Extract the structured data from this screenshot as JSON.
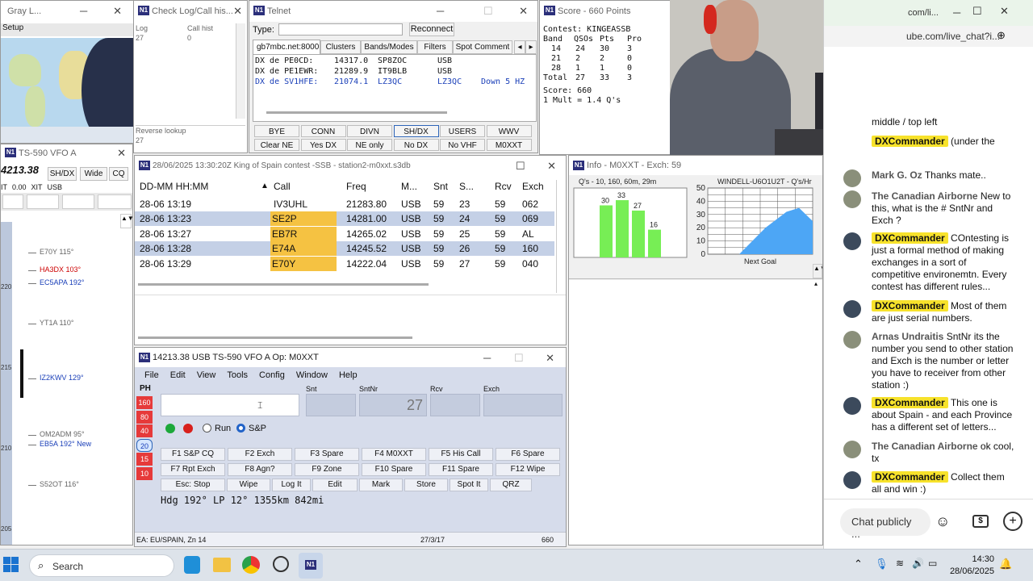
{
  "gray_line": {
    "title": "Gray L...",
    "setup": "Setup"
  },
  "check_log": {
    "title": "Check Log/Call his...",
    "log_label": "Log",
    "log_value": "27",
    "callhist_label": "Call hist",
    "callhist_value": "0",
    "reverse_label": "Reverse lookup",
    "reverse_value": "27"
  },
  "telnet": {
    "title": "Telnet",
    "type_label": "Type:",
    "reconnect": "Reconnect",
    "tabs": [
      "gb7mbc.net:8000",
      "Clusters",
      "Bands/Modes",
      "Filters",
      "Spot Comment"
    ],
    "spots": [
      {
        "de": "DX de PE0CD:",
        "freq": "14317.0",
        "call": "SP8ZOC",
        "mode": "USB",
        "extra": ""
      },
      {
        "de": "DX de PE1EWR:",
        "freq": "21289.9",
        "call": "IT9BLB",
        "mode": "USB",
        "extra": ""
      },
      {
        "de": "DX de SV1HFE:",
        "freq": "21074.1",
        "call": "LZ3QC",
        "mode": "LZ3QC",
        "extra": "Down 5 HZ"
      }
    ],
    "buttons_row1": [
      "BYE",
      "CONN",
      "DIVN",
      "SH/DX",
      "USERS",
      "WWV"
    ],
    "buttons_row2": [
      "Clear NE",
      "Yes DX",
      "NE only",
      "No DX",
      "No VHF",
      "M0XXT"
    ]
  },
  "score": {
    "title": "Score - 660 Points",
    "contest": "Contest: KINGEASSB",
    "headers": [
      "Band",
      "QSOs",
      "Pts",
      "Pro"
    ],
    "rows": [
      [
        "14",
        "24",
        "30",
        "3"
      ],
      [
        "21",
        "2",
        "2",
        "0"
      ],
      [
        "28",
        "1",
        "1",
        "0"
      ]
    ],
    "total": [
      "Total",
      "27",
      "33",
      "3"
    ],
    "score_line": "Score: 660",
    "mult_line": "1 Mult = 1.4 Q's"
  },
  "vfo_small": {
    "title": "TS-590 VFO A",
    "freq": "4213.38",
    "shdx": "SH/DX",
    "wide": "Wide",
    "cq": "CQ",
    "rit_label": "IT",
    "rit_value": "0.00",
    "xit": "XIT",
    "mode": "USB",
    "bandmap": [
      {
        "call": "E70Y 115°",
        "color": "#666"
      },
      {
        "call": "HA3DX 103°",
        "color": "#c00"
      },
      {
        "call": "EC5APA 192°",
        "color": "#1a3fb8"
      },
      {
        "call": "YT1A 110°",
        "color": "#666"
      },
      {
        "call": "IZ2KWV 129°",
        "color": "#1a3fb8"
      },
      {
        "call": "OM2ADM 95°",
        "color": "#666"
      },
      {
        "call": "EB5A 192° New",
        "color": "#1a3fb8"
      },
      {
        "call": "S52OT 116°",
        "color": "#666"
      }
    ],
    "scale": [
      "220",
      "215",
      "210",
      "205"
    ]
  },
  "log": {
    "title": "28/06/2025 13:30:20Z  King of Spain contest -SSB - station2-m0xxt.s3db",
    "headers": [
      "DD-MM HH:MM",
      "Call",
      "Freq",
      "M...",
      "Snt",
      "S...",
      "Rcv",
      "Exch"
    ],
    "rows": [
      [
        "28-06 13:19",
        "IV3UHL",
        "21283.80",
        "USB",
        "59",
        "23",
        "59",
        "062"
      ],
      [
        "28-06 13:23",
        "SE2P",
        "14281.00",
        "USB",
        "59",
        "24",
        "59",
        "069"
      ],
      [
        "28-06 13:27",
        "EB7R",
        "14265.02",
        "USB",
        "59",
        "25",
        "59",
        "AL"
      ],
      [
        "28-06 13:28",
        "E74A",
        "14245.52",
        "USB",
        "59",
        "26",
        "59",
        "160"
      ],
      [
        "28-06 13:29",
        "E70Y",
        "14222.04",
        "USB",
        "59",
        "27",
        "59",
        "040"
      ]
    ]
  },
  "info": {
    "title": "Info - M0XXT - Exch: 59",
    "chart1_title": "Q's - 10, 160, 60m, 29m",
    "chart2_title": "WINDELL-U6O1U2T - Q's/Hr",
    "next_goal": "Next Goal"
  },
  "chart_data": [
    {
      "type": "bar",
      "title": "Q's - 10, 160, 60m, 29m",
      "values": [
        30,
        33,
        27,
        16
      ],
      "data_labels": [
        "30",
        "33",
        "27",
        "16"
      ]
    },
    {
      "type": "area",
      "title": "WINDELL-U6O1U2T - Q's/Hr",
      "ylim": [
        0,
        50
      ],
      "yticks": [
        "50",
        "45",
        "40",
        "35",
        "30",
        "25",
        "20",
        "15",
        "10",
        "5",
        "0"
      ],
      "values": [
        0,
        20,
        32,
        35,
        25
      ],
      "xlabel": "Next Goal"
    }
  ],
  "entry": {
    "title": "14213.38 USB TS-590 VFO A   Op: M0XXT",
    "menu": [
      "File",
      "Edit",
      "View",
      "Tools",
      "Config",
      "Window",
      "Help"
    ],
    "mode": "PH",
    "bands": [
      "160",
      "80",
      "40",
      "20",
      "15",
      "10"
    ],
    "field_labels": [
      "Snt",
      "SntNr",
      "Rcv",
      "Exch"
    ],
    "sntnr": "27",
    "run": "Run",
    "sp": "S&P",
    "fkeys": [
      [
        "F1 S&P CQ",
        "F2 Exch",
        "F3 Spare",
        "F4 M0XXT",
        "F5 His Call",
        "F6 Spare"
      ],
      [
        "F7 Rpt Exch",
        "F8 Agn?",
        "F9 Zone",
        "F10 Spare",
        "F11 Spare",
        "F12 Wipe"
      ],
      [
        "Esc: Stop",
        "Wipe",
        "Log It",
        "Edit",
        "Mark",
        "Store",
        "Spot It",
        "QRZ"
      ]
    ],
    "heading": "Hdg 192°  LP 12°  1355km  842mi",
    "status_left": "EA: EU/SPAIN, Zn 14",
    "status_mid": "27/3/17",
    "status_right": "660"
  },
  "browser": {
    "url1": "com/li...",
    "url2": "ube.com/live_chat?i..."
  },
  "chat": {
    "messages": [
      {
        "author": "",
        "badge": true,
        "text": "middle / top left"
      },
      {
        "author": "DXCommander",
        "badge": true,
        "text": "(under the"
      },
      {
        "author": "Mark G. Oz",
        "badge": false,
        "text": "Thanks mate.."
      },
      {
        "author": "The Canadian Airborne",
        "badge": false,
        "text": "New to this, what is the # SntNr and Exch ?"
      },
      {
        "author": "DXCommander",
        "badge": true,
        "text": "COntesting is just a formal method of making exchanges in a sort of competitive environemtn. Every contest has different rules..."
      },
      {
        "author": "DXCommander",
        "badge": true,
        "text": "Most of them are just serial numbers."
      },
      {
        "author": "Arnas Undraitis",
        "badge": false,
        "text": "SntNr its the number you send to other station and Exch is the number or letter you have to receiver from other station :)"
      },
      {
        "author": "DXCommander",
        "badge": true,
        "text": "This one is about Spain - and each Province has a different set of letters..."
      },
      {
        "author": "The Canadian Airborne",
        "badge": false,
        "text": "ok cool, tx"
      },
      {
        "author": "DXCommander",
        "badge": true,
        "text": "Collect them all and win :)"
      }
    ],
    "input_placeholder": "Chat publicly ..."
  },
  "taskbar": {
    "search": "Search",
    "time": "14:30",
    "date": "28/06/2025"
  }
}
